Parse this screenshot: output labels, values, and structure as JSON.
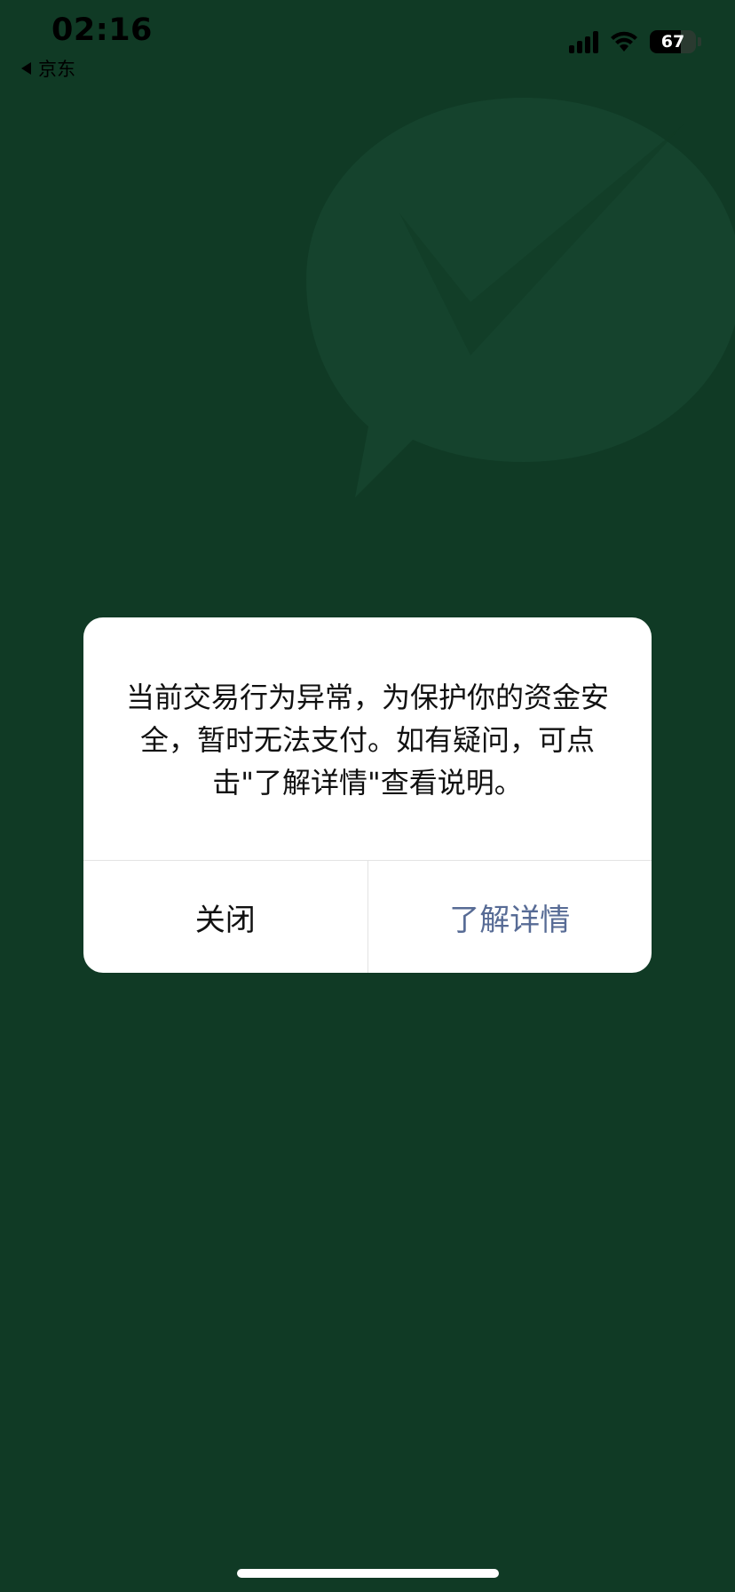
{
  "status_bar": {
    "time": "02:16",
    "back_label": "京东",
    "battery_percent": "67",
    "battery_level": 0.67
  },
  "dialog": {
    "message": "当前交易行为异常，为保护你的资金安全，暂时无法支付。如有疑问，可点击\"了解详情\"查看说明。",
    "close_label": "关闭",
    "details_label": "了解详情"
  },
  "colors": {
    "background": "#103a25",
    "link": "#576b95"
  },
  "icons": {
    "watermark": "wechat-pay-logo-icon",
    "signal": "signal-icon",
    "wifi": "wifi-icon",
    "battery": "battery-icon",
    "back": "back-triangle-icon"
  }
}
